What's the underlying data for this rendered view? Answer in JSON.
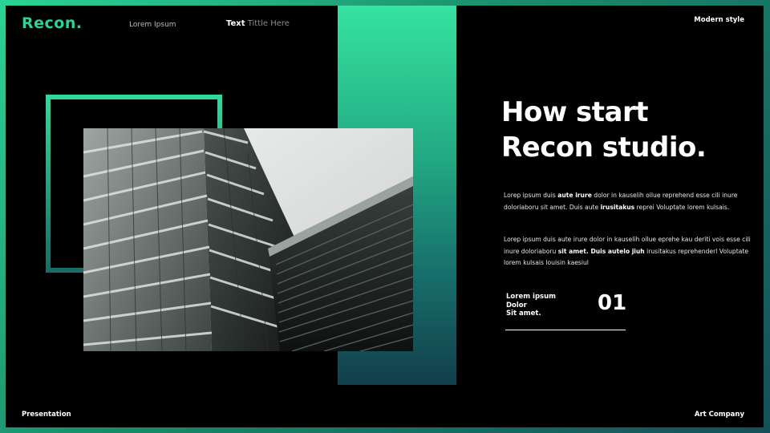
{
  "header": {
    "logo": "Recon.",
    "nav_link": "Lorem Ipsum",
    "nav_title_strong": "Text",
    "nav_title_rest": "Tittle Here",
    "tag": "Modern style"
  },
  "footer": {
    "left": "Presentation",
    "right": "Art Company"
  },
  "main": {
    "headline_line1": "How start",
    "headline_line2": "Recon studio.",
    "para1": {
      "t1": "Lorep  ipsum duis ",
      "b1": "aute irure",
      "t2": " dolor in kauselih oilue reprehend esse cili inure doloriaboru sit amet. Duis aute ",
      "b2": "irusitakus",
      "t3": " reprei Voluptate lorem kulsais."
    },
    "para2": {
      "t1": "Lorep  ipsum duis aute irure dolor in kauselih oilue eprehe kau deriti vois esse cili inure doloriaboru ",
      "b1": "sit amet. Duis autelo jiuh",
      "t2": " irusitakus reprehenderl Voluptate lorem kulsais louisin kaesiul"
    },
    "stat": {
      "label_line1": "Lorem ipsum",
      "label_line2": "Dolor",
      "label_line3": "Sit amet.",
      "number": "01"
    }
  },
  "colors": {
    "accent": "#2ad495",
    "panel_top": "#36e3a0",
    "panel_bottom": "#123f4b",
    "background": "#000000"
  },
  "image": {
    "subject": "modern glass office building facade",
    "icon": "building-photo"
  }
}
